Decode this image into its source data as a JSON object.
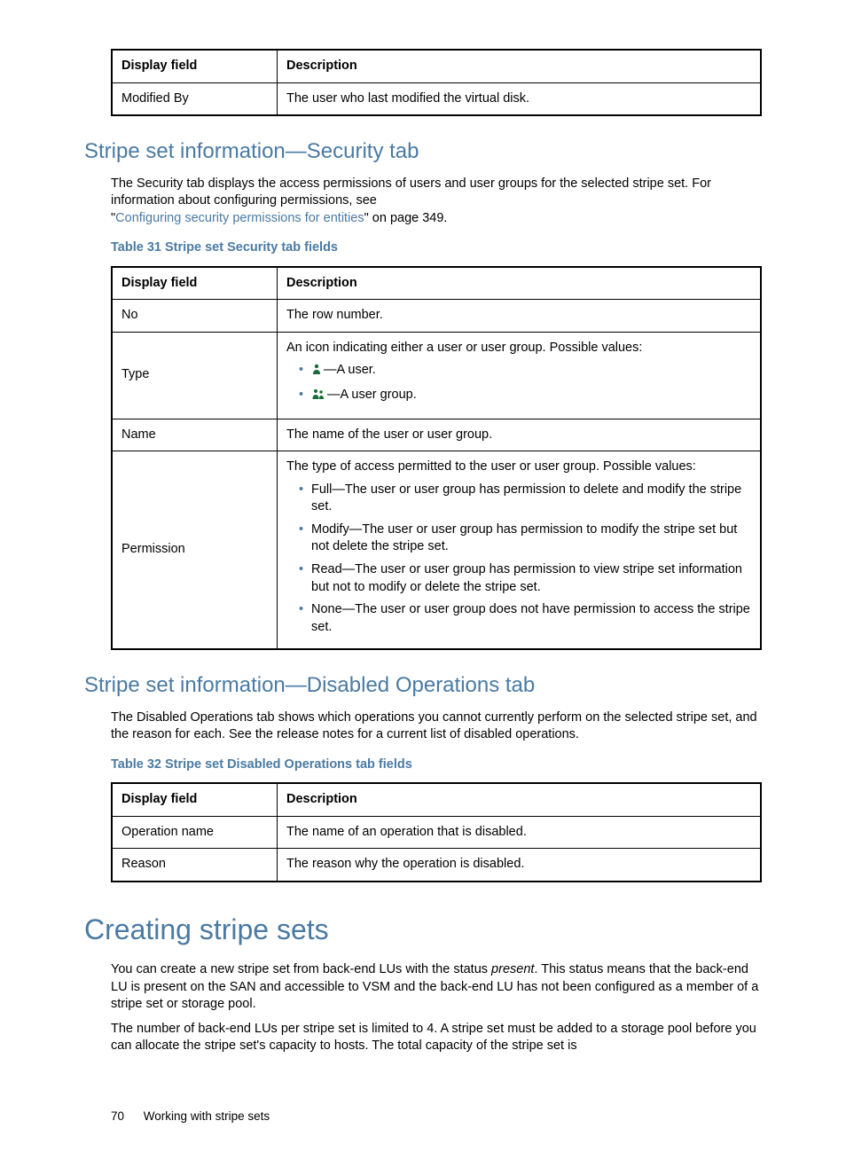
{
  "table1": {
    "headers": [
      "Display field",
      "Description"
    ],
    "rows": [
      {
        "field": "Modified By",
        "desc": "The user who last modified the virtual disk."
      }
    ]
  },
  "sec1": {
    "heading": "Stripe set information—Security tab",
    "para": "The Security tab displays the access permissions of users and user groups for the selected stripe set. For information about configuring permissions, see",
    "link_text": "Configuring security permissions for entities",
    "link_suffix": "\" on page 349.",
    "link_prefix": "\"",
    "caption": "Table 31 Stripe set Security tab fields",
    "headers": [
      "Display field",
      "Description"
    ],
    "row_no": {
      "field": "No",
      "desc": "The row number."
    },
    "row_type": {
      "field": "Type",
      "intro": "An icon indicating either a user or user group. Possible values:",
      "user": "—A user.",
      "group": "—A user group."
    },
    "row_name": {
      "field": "Name",
      "desc": "The name of the user or user group."
    },
    "row_perm": {
      "field": "Permission",
      "intro": "The type of access permitted to the user or user group. Possible values:",
      "full": "Full—The user or user group has permission to delete and modify the stripe set.",
      "modify": "Modify—The user or user group has permission to modify the stripe set but not delete the stripe set.",
      "read": "Read—The user or user group has permission to view stripe set information but not to modify or delete the stripe set.",
      "none": "None—The user or user group does not have permission to access the stripe set."
    }
  },
  "sec2": {
    "heading": "Stripe set information—Disabled Operations tab",
    "para": "The Disabled Operations tab shows which operations you cannot currently perform on the selected stripe set, and the reason for each. See the release notes for a current list of disabled operations.",
    "caption": "Table 32 Stripe set Disabled Operations tab fields",
    "headers": [
      "Display field",
      "Description"
    ],
    "rows": [
      {
        "field": "Operation name",
        "desc": "The name of an operation that is disabled."
      },
      {
        "field": "Reason",
        "desc": "The reason why the operation is disabled."
      }
    ]
  },
  "sec3": {
    "heading": "Creating stripe sets",
    "p1_a": "You can create a new stripe set from back-end LUs with the status ",
    "p1_i": "present",
    "p1_b": ". This status means that the back-end LU is present on the SAN and accessible to VSM and the back-end LU has not been configured as a member of a stripe set or storage pool.",
    "p2": "The number of back-end LUs per stripe set is limited to 4. A stripe set must be added to a storage pool before you can allocate the stripe set's capacity to hosts. The total capacity of the stripe set is"
  },
  "footer": {
    "page": "70",
    "title": "Working with stripe sets"
  }
}
